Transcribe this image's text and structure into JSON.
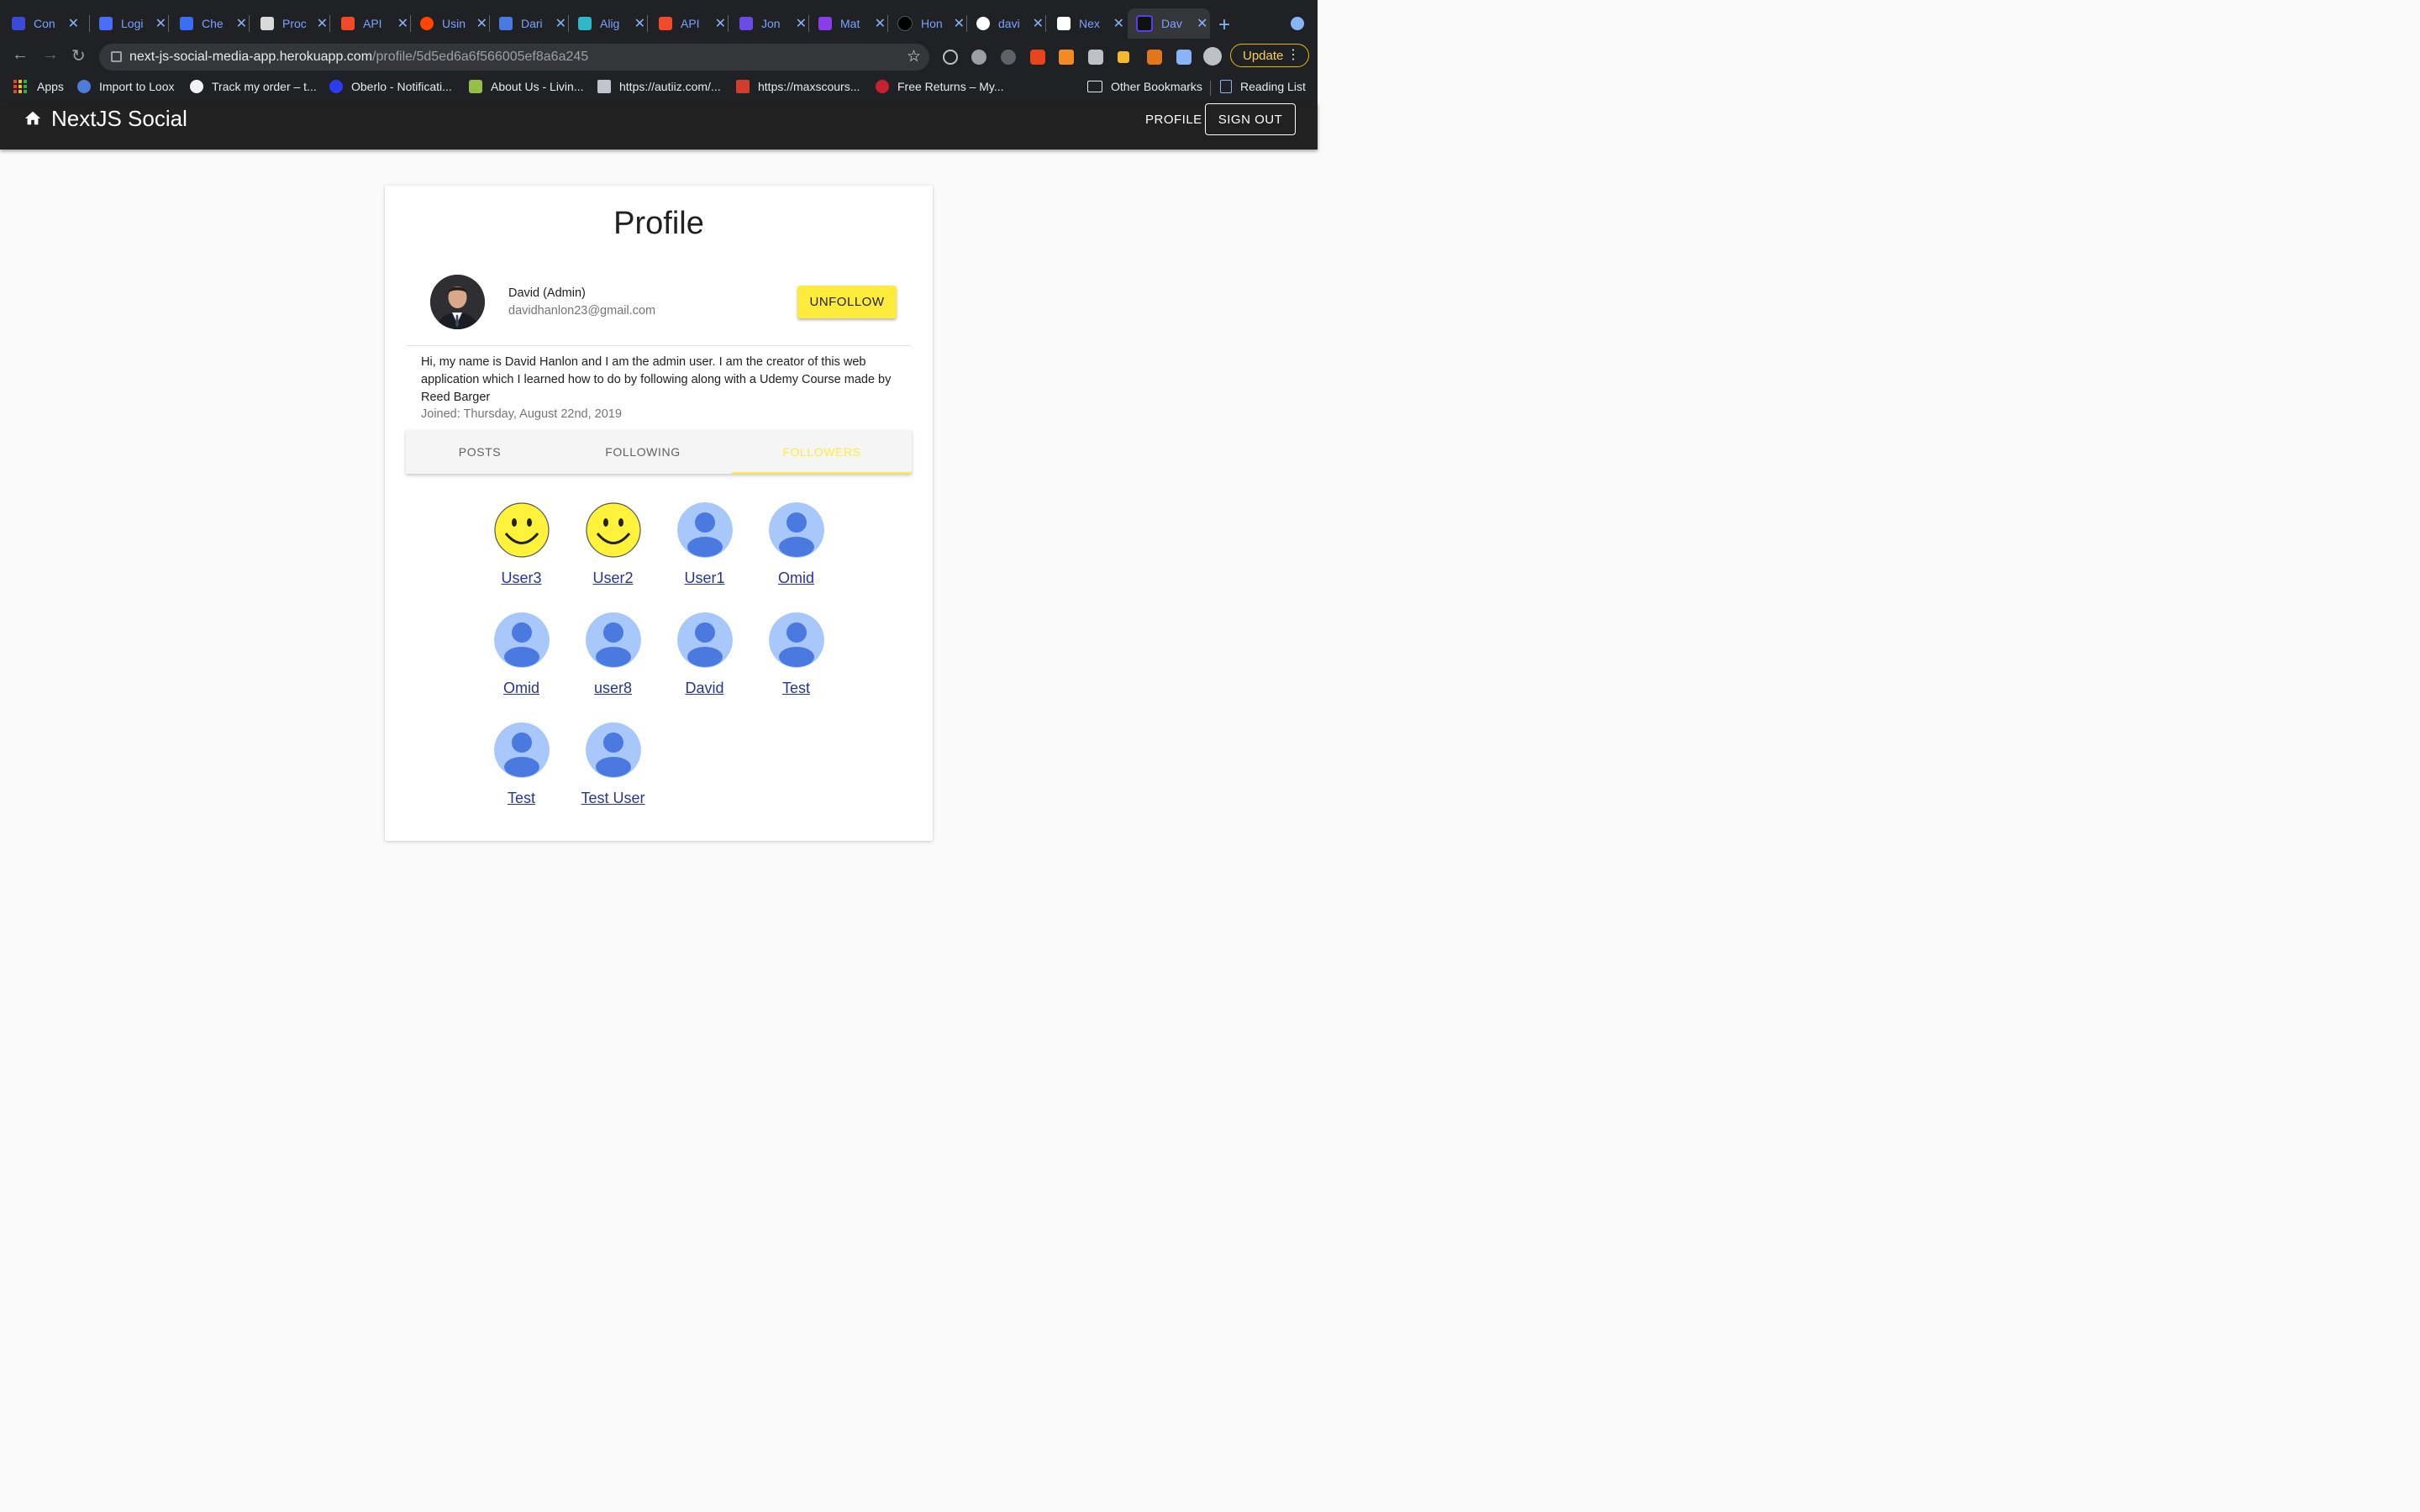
{
  "browser": {
    "tabs": [
      {
        "label": "Con",
        "color": "#3c4bd6"
      },
      {
        "label": "Logi",
        "color": "#4a6cf7"
      },
      {
        "label": "Che",
        "color": "#3b6df5"
      },
      {
        "label": "Proc",
        "color": "#d9d9d9"
      },
      {
        "label": "API",
        "color": "#f04a2a"
      },
      {
        "label": "Usin",
        "color": "#ff4500"
      },
      {
        "label": "Dari",
        "color": "#4a7ae0"
      },
      {
        "label": "Alig",
        "color": "#2eb7c8"
      },
      {
        "label": "API",
        "color": "#f04a2a"
      },
      {
        "label": "Jon",
        "color": "#6b4de6"
      },
      {
        "label": "Mat",
        "color": "#8b3de8"
      },
      {
        "label": "Hon",
        "color": "#000000"
      },
      {
        "label": "davi",
        "color": "#ffffff"
      },
      {
        "label": "Nex",
        "color": "#ffffff"
      },
      {
        "label": "Dav",
        "color": "#5a3ee8"
      }
    ],
    "close_glyph": "✕",
    "new_tab_glyph": "+",
    "url_domain": "next-js-social-media-app.herokuapp.com",
    "url_path": "/profile/5d5ed6a6f566005ef8a6a245",
    "update_label": "Update",
    "bookmarks": [
      {
        "label": "Apps"
      },
      {
        "label": "Import to Loox",
        "color": "#4c7bd9"
      },
      {
        "label": "Track my order – t...",
        "color": "#f2f2f2"
      },
      {
        "label": "Oberlo - Notificati...",
        "color": "#2b3cf2"
      },
      {
        "label": "About Us - Livin...",
        "color": "#95bf47"
      },
      {
        "label": "https://autiiz.com/...",
        "color": "#c0c4cc"
      },
      {
        "label": "https://maxscours...",
        "color": "#d23c2a"
      },
      {
        "label": "Free Returns – My...",
        "color": "#c8202f"
      },
      {
        "label": "Other Bookmarks"
      },
      {
        "label": "Reading List"
      }
    ]
  },
  "appbar": {
    "brand": "NextJS Social",
    "profile_link": "PROFILE",
    "signout": "SIGN OUT"
  },
  "profile": {
    "title": "Profile",
    "name": "David (Admin)",
    "email": "davidhanlon23@gmail.com",
    "unfollow_label": "UNFOLLOW",
    "bio": "Hi, my name is David Hanlon and I am the admin user. I am the creator of this web application which I learned how to do by following along with a Udemy Course made by Reed Barger",
    "joined": "Joined: Thursday, August 22nd, 2019",
    "tabs": [
      {
        "label": "POSTS",
        "active": false
      },
      {
        "label": "FOLLOWING",
        "active": false
      },
      {
        "label": "FOLLOWERS",
        "active": true
      }
    ],
    "followers": [
      {
        "name": "User3",
        "avatar": "smiley"
      },
      {
        "name": "User2",
        "avatar": "smiley"
      },
      {
        "name": "User1",
        "avatar": "default"
      },
      {
        "name": "Omid",
        "avatar": "default"
      },
      {
        "name": "Omid",
        "avatar": "default"
      },
      {
        "name": "user8",
        "avatar": "default"
      },
      {
        "name": "David",
        "avatar": "default"
      },
      {
        "name": "Test",
        "avatar": "default"
      },
      {
        "name": "Test",
        "avatar": "default"
      },
      {
        "name": "Test User",
        "avatar": "default"
      }
    ]
  }
}
